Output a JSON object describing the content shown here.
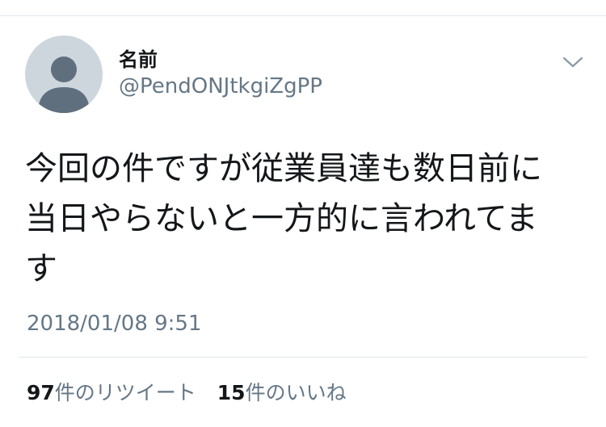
{
  "tweet": {
    "author": {
      "display_name": "名前",
      "handle": "@PendONJtkgiZgPP"
    },
    "text_lines": [
      "今回の件ですが従業員達も数日前に",
      "当日やらないと一方的に言われてま",
      "す"
    ],
    "timestamp": "2018/01/08 9:51",
    "stats": {
      "retweets": {
        "count": "97",
        "label": "件のリツイート"
      },
      "likes": {
        "count": "15",
        "label": "件のいいね"
      }
    }
  },
  "icons": {
    "avatar": "default-profile-icon",
    "menu": "chevron-down-icon"
  },
  "colors": {
    "text": "#14171a",
    "secondary_text": "#657786",
    "divider": "#e1e8ed",
    "avatar_background": "#cdd6dd",
    "avatar_silhouette": "#5f6f7d"
  }
}
